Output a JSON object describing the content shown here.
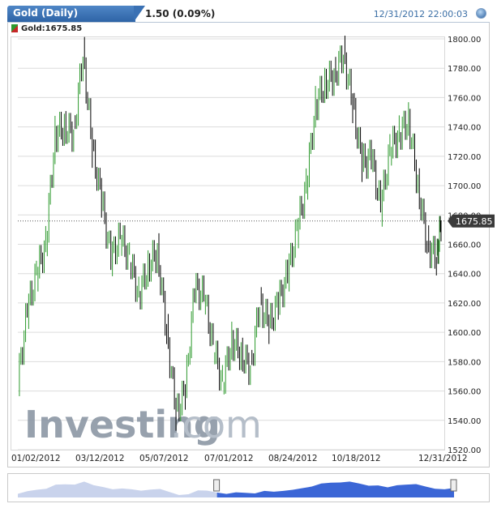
{
  "header": {
    "instrument": "Gold (Daily)",
    "change": "1.50 (0.09%)",
    "datetime": "12/31/2012 22:00:03"
  },
  "legend": {
    "label": "Gold:1675.85"
  },
  "price_label": "1675.85",
  "watermark": {
    "main": "Investing",
    "suffix": ".com"
  },
  "colors": {
    "tab": "#3a71b4",
    "up": "#2e9a2e",
    "down": "#000000",
    "grid": "#dcdcdc",
    "nav_fill": "#3b66d6",
    "nav_dim": "#c9d3ec",
    "price_tag": "#3a3a3a"
  },
  "chart_data": {
    "type": "line",
    "title": "Gold (Daily)",
    "ylim": [
      1520,
      1805
    ],
    "y_ticks": [
      1520,
      1540,
      1560,
      1580,
      1600,
      1620,
      1640,
      1660,
      1680,
      1700,
      1720,
      1740,
      1760,
      1780,
      1800
    ],
    "x_ticks": [
      "01/02/2012",
      "03/12/2012",
      "05/07/2012",
      "07/01/2012",
      "08/24/2012",
      "10/18/2012",
      "12/31/2012"
    ],
    "last_value": 1675.85,
    "series": [
      {
        "name": "Gold",
        "x": [
          "2012-01-02",
          "2012-01-10",
          "2012-01-18",
          "2012-01-26",
          "2012-02-03",
          "2012-02-11",
          "2012-02-19",
          "2012-02-27",
          "2012-03-06",
          "2012-03-14",
          "2012-03-22",
          "2012-03-30",
          "2012-04-07",
          "2012-04-15",
          "2012-04-23",
          "2012-05-01",
          "2012-05-09",
          "2012-05-17",
          "2012-05-25",
          "2012-06-02",
          "2012-06-10",
          "2012-06-18",
          "2012-06-26",
          "2012-07-04",
          "2012-07-12",
          "2012-07-20",
          "2012-07-28",
          "2012-08-05",
          "2012-08-13",
          "2012-08-21",
          "2012-08-29",
          "2012-09-06",
          "2012-09-14",
          "2012-09-22",
          "2012-09-30",
          "2012-10-08",
          "2012-10-16",
          "2012-10-24",
          "2012-11-01",
          "2012-11-09",
          "2012-11-17",
          "2012-11-25",
          "2012-12-03",
          "2012-12-11",
          "2012-12-19",
          "2012-12-27",
          "2012-12-31"
        ],
        "values": [
          1566,
          1615,
          1640,
          1660,
          1735,
          1740,
          1735,
          1790,
          1725,
          1690,
          1650,
          1665,
          1650,
          1625,
          1645,
          1655,
          1600,
          1545,
          1560,
          1630,
          1625,
          1590,
          1565,
          1595,
          1585,
          1575,
          1620,
          1605,
          1620,
          1640,
          1670,
          1700,
          1755,
          1770,
          1775,
          1790,
          1755,
          1715,
          1720,
          1685,
          1725,
          1735,
          1745,
          1700,
          1660,
          1650,
          1675
        ]
      }
    ],
    "navigator": {
      "range_start_index": 21,
      "range_end_index": 46
    }
  }
}
